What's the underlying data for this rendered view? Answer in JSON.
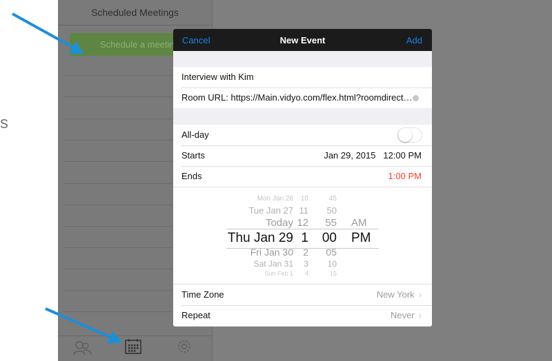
{
  "stray_text": "s",
  "sidebar": {
    "title": "Scheduled Meetings",
    "schedule_button": "Schedule a meeting"
  },
  "tabbar": {
    "tabs": [
      "contacts-icon",
      "calendar-icon",
      "settings-icon"
    ],
    "active": "calendar-icon"
  },
  "modal": {
    "cancel": "Cancel",
    "title": "New Event",
    "add": "Add",
    "event_title": "Interview with Kim",
    "room_url": "Room URL: https://Main.vidyo.com/flex.html?roomdirect.ht…",
    "all_day_label": "All-day",
    "all_day_on": false,
    "starts_label": "Starts",
    "starts_date": "Jan 29, 2015",
    "starts_time": "12:00 PM",
    "ends_label": "Ends",
    "ends_time": "1:00 PM",
    "picker": {
      "dates": [
        "Mon Jan 26",
        "Tue Jan 27",
        "Today",
        "Thu Jan 29",
        "Fri Jan 30",
        "Sat Jan 31",
        "Sun Feb 1"
      ],
      "hours": [
        "10",
        "11",
        "12",
        "1",
        "2",
        "3",
        "4"
      ],
      "minutes": [
        "45",
        "50",
        "55",
        "00",
        "05",
        "10",
        "15"
      ],
      "ampm": [
        "AM",
        "PM"
      ]
    },
    "timezone_label": "Time Zone",
    "timezone_value": "New York",
    "repeat_label": "Repeat",
    "repeat_value": "Never"
  },
  "colors": {
    "accent_blue": "#1a82e8",
    "alert_red": "#ff3b30",
    "arrow_blue": "#1e8fd6",
    "button_green": "#5f8544"
  }
}
